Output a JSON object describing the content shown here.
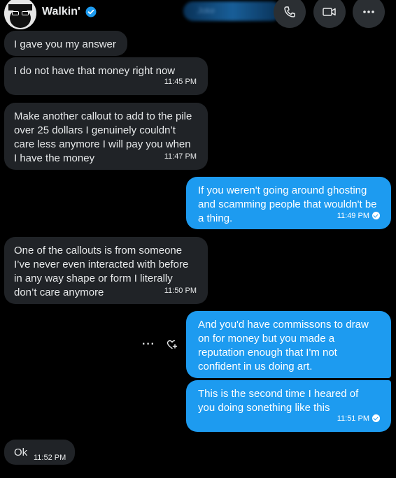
{
  "header": {
    "name": "Walkin'",
    "blurred_text": "Joke"
  },
  "messages": [
    {
      "text": "I gave you my answer",
      "time": ""
    },
    {
      "text": "I do not have that money right now",
      "time": "11:45 PM"
    },
    {
      "text": "Make another callout to add to the pile over 25 dollars I genuinely couldn’t care less anymore I will pay you when I have the money",
      "time": "11:47 PM"
    },
    {
      "text": "If you weren't going around ghosting and scamming people that wouldn't be a thing.",
      "time": "11:49 PM"
    },
    {
      "text": "One of the callouts is from someone I’ve never even interacted with before in any way shape or form I literally don’t care anymore",
      "time": "11:50 PM"
    },
    {
      "text": "And you'd have commissons to draw on for money but you made a reputation enough that I'm not confident in us doing art.",
      "time": ""
    },
    {
      "text": "This is the second time I heared of you doing sonething like this",
      "time": "11:51 PM"
    },
    {
      "text": "Ok",
      "time": "11:52 PM"
    }
  ],
  "actions": {
    "more": "···"
  },
  "colors": {
    "sent_bubble": "#1d9bf0",
    "received_bubble": "#202327",
    "background": "#000000"
  }
}
